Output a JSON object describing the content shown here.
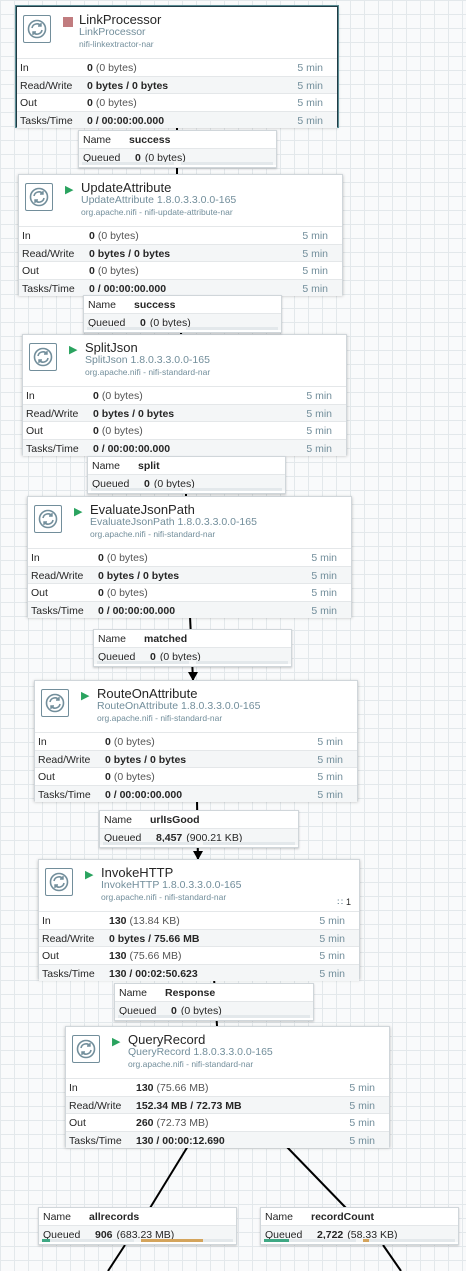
{
  "processors": [
    {
      "name": "LinkProcessor",
      "type": "LinkProcessor",
      "bundle": "nifi-linkextractor-nar",
      "state": "stopped",
      "in_count": "0",
      "in_size": "(0 bytes)",
      "rw": "0 bytes / 0 bytes",
      "out_count": "0",
      "out_size": "(0 bytes)",
      "tasks": "0 / 00:00:00.000"
    },
    {
      "name": "UpdateAttribute",
      "type": "UpdateAttribute 1.8.0.3.3.0.0-165",
      "bundle": "org.apache.nifi - nifi-update-attribute-nar",
      "state": "running",
      "in_count": "0",
      "in_size": "(0 bytes)",
      "rw": "0 bytes / 0 bytes",
      "out_count": "0",
      "out_size": "(0 bytes)",
      "tasks": "0 / 00:00:00.000"
    },
    {
      "name": "SplitJson",
      "type": "SplitJson 1.8.0.3.3.0.0-165",
      "bundle": "org.apache.nifi - nifi-standard-nar",
      "state": "running",
      "in_count": "0",
      "in_size": "(0 bytes)",
      "rw": "0 bytes / 0 bytes",
      "out_count": "0",
      "out_size": "(0 bytes)",
      "tasks": "0 / 00:00:00.000"
    },
    {
      "name": "EvaluateJsonPath",
      "type": "EvaluateJsonPath 1.8.0.3.3.0.0-165",
      "bundle": "org.apache.nifi - nifi-standard-nar",
      "state": "running",
      "in_count": "0",
      "in_size": "(0 bytes)",
      "rw": "0 bytes / 0 bytes",
      "out_count": "0",
      "out_size": "(0 bytes)",
      "tasks": "0 / 00:00:00.000"
    },
    {
      "name": "RouteOnAttribute",
      "type": "RouteOnAttribute 1.8.0.3.3.0.0-165",
      "bundle": "org.apache.nifi - nifi-standard-nar",
      "state": "running",
      "in_count": "0",
      "in_size": "(0 bytes)",
      "rw": "0 bytes / 0 bytes",
      "out_count": "0",
      "out_size": "(0 bytes)",
      "tasks": "0 / 00:00:00.000"
    },
    {
      "name": "InvokeHTTP",
      "type": "InvokeHTTP 1.8.0.3.3.0.0-165",
      "bundle": "org.apache.nifi - nifi-standard-nar",
      "state": "running",
      "active_threads": "1",
      "in_count": "130",
      "in_size": "(13.84 KB)",
      "rw": "0 bytes / 75.66 MB",
      "out_count": "130",
      "out_size": "(75.66 MB)",
      "tasks": "130 / 00:02:50.623"
    },
    {
      "name": "QueryRecord",
      "type": "QueryRecord 1.8.0.3.3.0.0-165",
      "bundle": "org.apache.nifi - nifi-standard-nar",
      "state": "running",
      "in_count": "130",
      "in_size": "(75.66 MB)",
      "rw": "152.34 MB / 72.73 MB",
      "out_count": "260",
      "out_size": "(72.73 MB)",
      "tasks": "130 / 00:00:12.690"
    }
  ],
  "row_labels": {
    "in": "In",
    "rw": "Read/Write",
    "out": "Out",
    "tasks": "Tasks/Time",
    "window": "5 min"
  },
  "connections": [
    {
      "name": "success",
      "queued_count": "0",
      "queued_size": "(0 bytes)",
      "fill_count": 0,
      "fill_size": 0
    },
    {
      "name": "success",
      "queued_count": "0",
      "queued_size": "(0 bytes)",
      "fill_count": 0,
      "fill_size": 0
    },
    {
      "name": "split",
      "queued_count": "0",
      "queued_size": "(0 bytes)",
      "fill_count": 0,
      "fill_size": 0
    },
    {
      "name": "matched",
      "queued_count": "0",
      "queued_size": "(0 bytes)",
      "fill_count": 0,
      "fill_size": 0
    },
    {
      "name": "urlIsGood",
      "queued_count": "8,457",
      "queued_size": "(900.21 KB)",
      "fill_count": 0,
      "fill_size": 0
    },
    {
      "name": "Response",
      "queued_count": "0",
      "queued_size": "(0 bytes)",
      "fill_count": 0,
      "fill_size": 0
    },
    {
      "name": "allrecords",
      "queued_count": "906",
      "queued_size": "(683.23 MB)",
      "fill_count": 0.09,
      "fill_size": 0.67
    },
    {
      "name": "recordCount",
      "queued_count": "2,722",
      "queued_size": "(58.33 KB)",
      "fill_count": 0.27,
      "fill_size": 0.06
    }
  ],
  "conn_labels": {
    "name": "Name",
    "queued": "Queued"
  },
  "colors": {
    "running": "#2aa35f",
    "stopped": "#c17c7f",
    "fill_count": "#3fa884",
    "fill_size": "#d4a45c",
    "link": "#000000"
  }
}
